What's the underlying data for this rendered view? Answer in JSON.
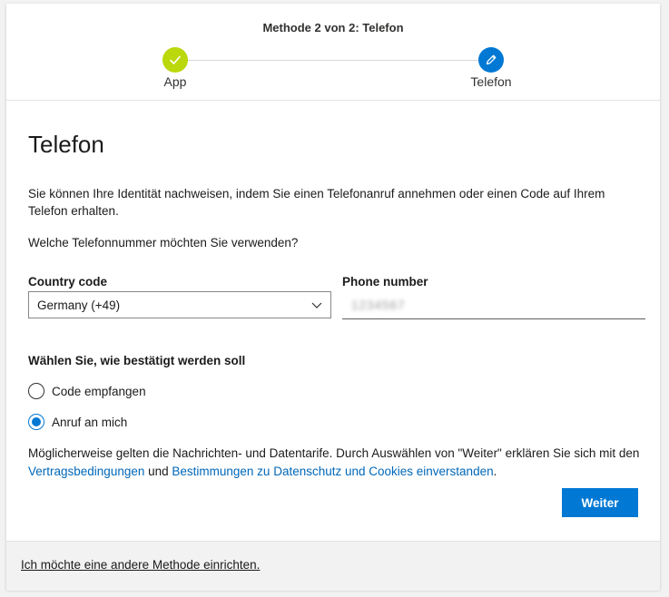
{
  "header": {
    "method_title": "Methode 2 von 2: Telefon",
    "steps": [
      {
        "label": "App",
        "state": "done",
        "icon": "check-icon",
        "color": "#bad80a"
      },
      {
        "label": "Telefon",
        "state": "current",
        "icon": "pencil-icon",
        "color": "#0078d4"
      }
    ]
  },
  "main": {
    "title": "Telefon",
    "description": "Sie können Ihre Identität nachweisen, indem Sie einen Telefonanruf annehmen oder einen Code auf Ihrem Telefon erhalten.",
    "question": "Welche Telefonnummer möchten Sie verwenden?",
    "country_code": {
      "label": "Country code",
      "selected": "Germany (+49)"
    },
    "phone_number": {
      "label": "Phone number",
      "value": "1234567"
    },
    "verify_section": {
      "title": "Wählen Sie, wie bestätigt werden soll",
      "options": [
        {
          "label": "Code empfangen",
          "checked": false
        },
        {
          "label": "Anruf an mich",
          "checked": true
        }
      ]
    },
    "legal": {
      "text_before": "Möglicherweise gelten die Nachrichten- und Datentarife. Durch Auswählen von \"Weiter\" erklären Sie sich mit den ",
      "terms_link": "Vertragsbedingungen",
      "text_middle": " und ",
      "privacy_link": "Bestimmungen zu Datenschutz und Cookies einverstanden",
      "text_after": "."
    },
    "next_button": "Weiter"
  },
  "footer": {
    "other_method_link": "Ich möchte eine andere Methode einrichten."
  },
  "colors": {
    "accent": "#0078d4",
    "success": "#bad80a",
    "link": "#0067b8"
  }
}
